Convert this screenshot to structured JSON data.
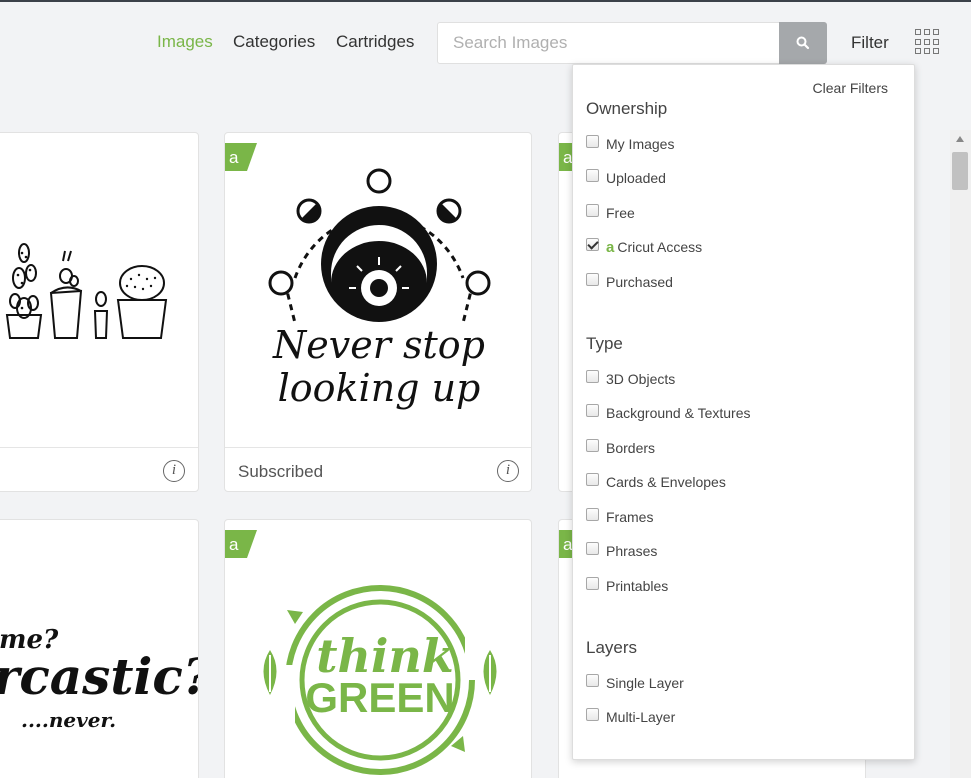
{
  "nav": {
    "images_label": "Images",
    "categories_label": "Categories",
    "cartridges_label": "Cartridges"
  },
  "search": {
    "placeholder": "Search Images",
    "icon": "search-icon"
  },
  "filter_label": "Filter",
  "view_icon": "grid-view-icon",
  "cards": [
    {
      "art": "cactus-plants-art",
      "status": "",
      "badge": false
    },
    {
      "art": "never-stop-looking-up-art",
      "art_text_line1": "Never stop",
      "art_text_line2": "looking up",
      "status": "Subscribed",
      "badge": true
    },
    {
      "art": "sarcastic-quote-art",
      "art_text_line1": "me?",
      "art_text_line2": "rcastic?",
      "art_text_line3": "....never.",
      "badge": false
    },
    {
      "art": "think-green-art",
      "art_text_line1": "think",
      "art_text_line2": "GREEN",
      "badge": true
    }
  ],
  "filters": {
    "clear_label": "Clear Filters",
    "ownership": {
      "title": "Ownership",
      "options": [
        {
          "label": "My Images",
          "checked": false
        },
        {
          "label": "Uploaded",
          "checked": false
        },
        {
          "label": "Free",
          "checked": false
        },
        {
          "label": "Cricut Access",
          "checked": true
        },
        {
          "label": "Purchased",
          "checked": false
        }
      ]
    },
    "type": {
      "title": "Type",
      "options": [
        {
          "label": "3D Objects",
          "checked": false
        },
        {
          "label": "Background & Textures",
          "checked": false
        },
        {
          "label": "Borders",
          "checked": false
        },
        {
          "label": "Cards & Envelopes",
          "checked": false
        },
        {
          "label": "Frames",
          "checked": false
        },
        {
          "label": "Phrases",
          "checked": false
        },
        {
          "label": "Printables",
          "checked": false
        }
      ]
    },
    "layers": {
      "title": "Layers",
      "options": [
        {
          "label": "Single Layer",
          "checked": false
        },
        {
          "label": "Multi-Layer",
          "checked": false
        }
      ]
    }
  },
  "colors": {
    "accent": "#7ab648",
    "search_button": "#a5a8ab",
    "background": "#f2f3f5"
  }
}
